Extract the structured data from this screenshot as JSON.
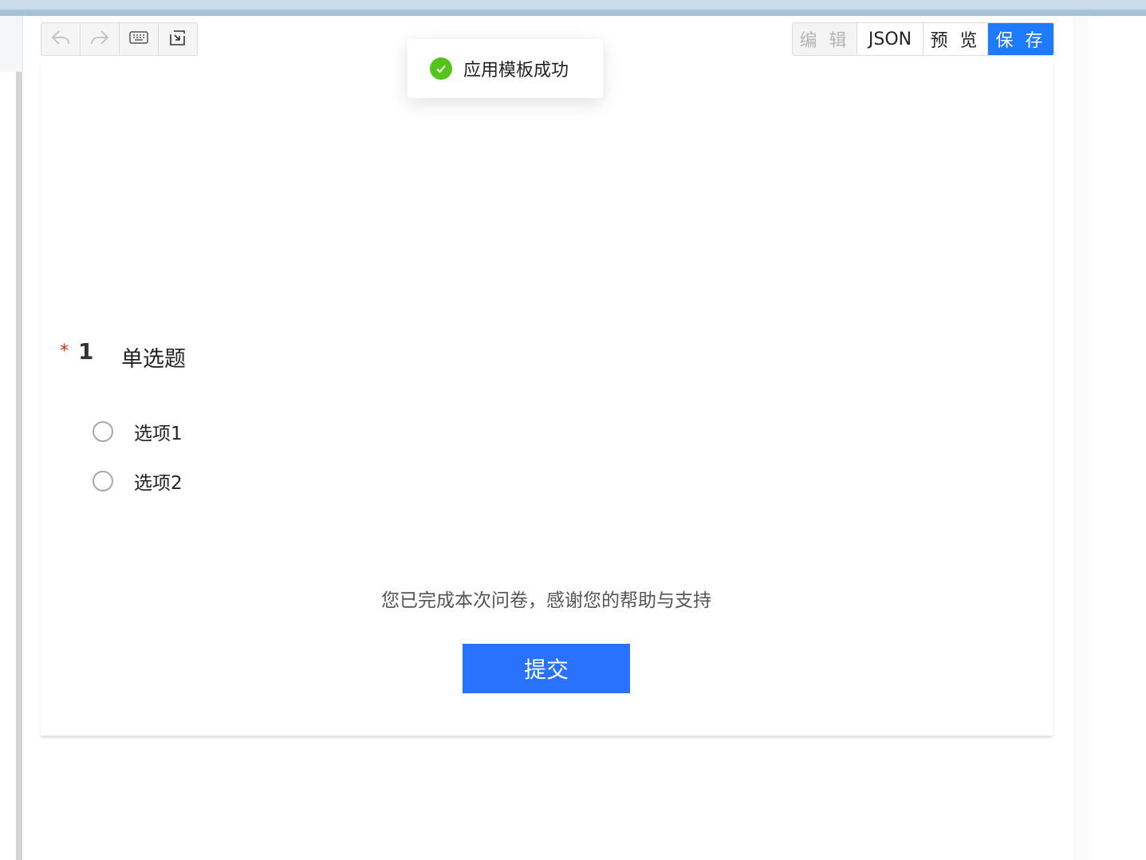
{
  "toolbar": {
    "undo_icon": "undo-icon",
    "redo_icon": "redo-icon",
    "keyboard_icon": "keyboard-icon",
    "import_icon": "import-icon",
    "edit_label": "编 辑",
    "json_label": "JSON",
    "preview_label": "预 览",
    "save_label": "保 存"
  },
  "toast": {
    "message": "应用模板成功",
    "icon": "check-circle-icon",
    "color": "#52c41a"
  },
  "question": {
    "required_mark": "*",
    "number": "1",
    "title": "单选题",
    "options": [
      {
        "label": "选项1"
      },
      {
        "label": "选项2"
      }
    ]
  },
  "footer": {
    "thanks_text": "您已完成本次问卷，感谢您的帮助与支持",
    "submit_label": "提交"
  },
  "colors": {
    "primary": "#1e7bff",
    "submit": "#2872ff",
    "required": "#e02020"
  }
}
